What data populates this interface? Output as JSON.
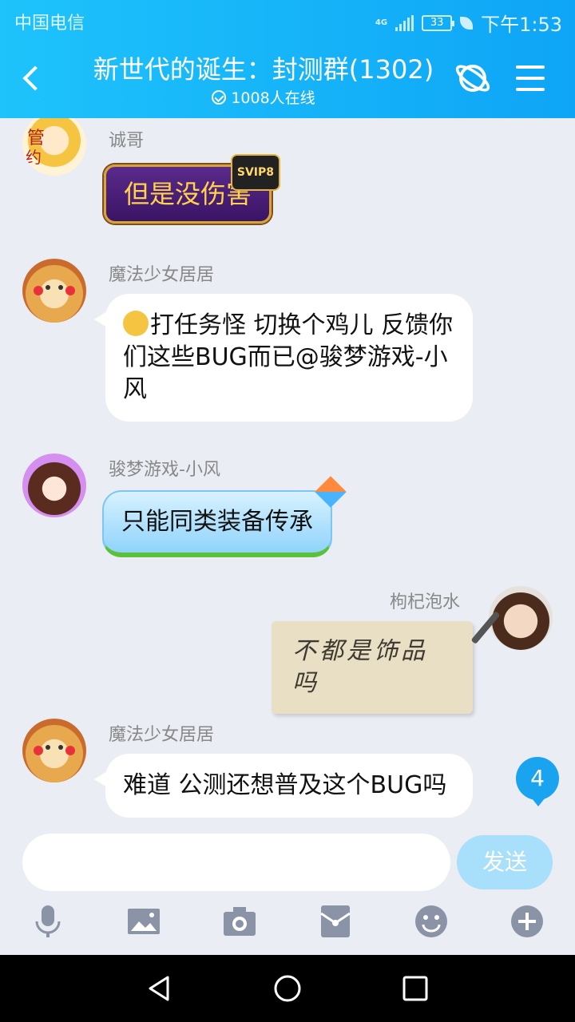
{
  "status_bar": {
    "carrier": "中国电信",
    "network": "4G",
    "battery": "33",
    "time": "下午1:53"
  },
  "header": {
    "title": "新世代的诞生：封测群(1302)",
    "online": "1008人在线"
  },
  "messages": [
    {
      "sender": "诚哥",
      "text": "但是没伤害",
      "badge": "SVIP8",
      "style": "svip"
    },
    {
      "sender": "魔法少女居居",
      "text": "打任务怪 切换个鸡儿 反馈你们这些BUG而已@骏梦游戏-小风",
      "style": "white"
    },
    {
      "sender": "骏梦游戏-小风",
      "text": "只能同类装备传承",
      "style": "kite"
    },
    {
      "sender": "枸杞泡水",
      "text": "不都是饰品吗",
      "style": "paper",
      "self": true
    },
    {
      "sender": "魔法少女居居",
      "text": "难道 公测还想普及这个BUG吗",
      "style": "white"
    }
  ],
  "unread_count": "4",
  "input": {
    "value": "",
    "send_label": "发送"
  },
  "toolbar": [
    "mic-icon",
    "image-icon",
    "camera-icon",
    "red-packet-icon",
    "emoji-icon",
    "plus-icon"
  ],
  "colors": {
    "header": "#12b2f8",
    "accent": "#1aa4f0",
    "send_disabled": "#a8dffa",
    "chat_bg": "#eaedf4"
  }
}
